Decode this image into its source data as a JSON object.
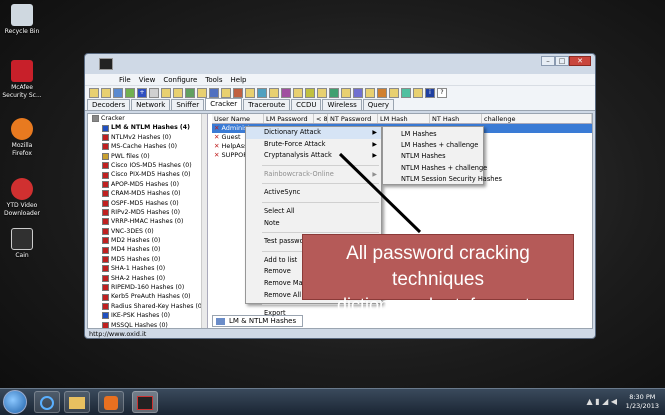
{
  "desktop": {
    "icons": [
      {
        "label": "Recycle Bin",
        "color": "#cfd8e0"
      },
      {
        "label": "McAfee Security Sc...",
        "color": "#c8202a"
      },
      {
        "label": "Mozilla Firefox",
        "color": "#e87a20"
      },
      {
        "label": "YTD Video Downloader",
        "color": "#d03030"
      },
      {
        "label": "Cain",
        "color": "#303030"
      }
    ]
  },
  "window": {
    "menu": [
      "File",
      "View",
      "Configure",
      "Tools",
      "Help"
    ],
    "tabs": [
      "Decoders",
      "Network",
      "Sniffer",
      "Cracker",
      "Traceroute",
      "CCDU",
      "Wireless",
      "Query"
    ],
    "active_tab": "Cracker",
    "tree": {
      "root": "Cracker",
      "items": [
        {
          "label": "LM & NTLM Hashes (4)",
          "bold": true
        },
        {
          "label": "NTLMv2 Hashes (0)"
        },
        {
          "label": "MS-Cache Hashes (0)"
        },
        {
          "label": "PWL files (0)"
        },
        {
          "label": "Cisco IOS-MD5 Hashes (0)"
        },
        {
          "label": "Cisco PIX-MD5 Hashes (0)"
        },
        {
          "label": "APOP-MD5 Hashes (0)"
        },
        {
          "label": "CRAM-MD5 Hashes (0)"
        },
        {
          "label": "OSPF-MD5 Hashes (0)"
        },
        {
          "label": "RIPv2-MD5 Hashes (0)"
        },
        {
          "label": "VRRP-HMAC Hashes (0)"
        },
        {
          "label": "VNC-3DES (0)"
        },
        {
          "label": "MD2 Hashes (0)"
        },
        {
          "label": "MD4 Hashes (0)"
        },
        {
          "label": "MD5 Hashes (0)"
        },
        {
          "label": "SHA-1 Hashes (0)"
        },
        {
          "label": "SHA-2 Hashes (0)"
        },
        {
          "label": "RIPEMD-160 Hashes (0)"
        },
        {
          "label": "Kerb5 PreAuth Hashes (0)"
        },
        {
          "label": "Radius Shared-Key Hashes (0)"
        },
        {
          "label": "IKE-PSK Hashes (0)"
        },
        {
          "label": "MSSQL Hashes (0)"
        }
      ]
    },
    "grid": {
      "columns": [
        "User Name",
        "LM Password",
        "< 8",
        "NT Password",
        "LM Hash",
        "NT Hash",
        "challenge"
      ],
      "rows": [
        "Administr",
        "Guest",
        "HelpAssis",
        "SUPPORT"
      ]
    },
    "bottom_tab": "LM & NTLM Hashes",
    "status": "http://www.oxid.it"
  },
  "context_menu": {
    "items": [
      {
        "label": "Dictionary Attack",
        "submenu": true,
        "highlight": true
      },
      {
        "label": "Brute-Force Attack",
        "submenu": true
      },
      {
        "label": "Cryptanalysis Attack",
        "submenu": true
      },
      {
        "sep": true
      },
      {
        "label": "Rainbowcrack-Online",
        "submenu": true,
        "disabled": true
      },
      {
        "sep": true
      },
      {
        "label": "ActiveSync"
      },
      {
        "sep": true
      },
      {
        "label": "Select All"
      },
      {
        "label": "Note"
      },
      {
        "sep": true
      },
      {
        "label": "Test password"
      },
      {
        "sep": true
      },
      {
        "label": "Add to list"
      },
      {
        "label": "Remove"
      },
      {
        "label": "Remove Machine Accounts"
      },
      {
        "label": "Remove All"
      },
      {
        "sep": true
      },
      {
        "label": "Export"
      }
    ]
  },
  "submenu": [
    "LM Hashes",
    "LM Hashes + challenge",
    "NTLM Hashes",
    "NTLM Hashes + challenge",
    "NTLM Session Security Hashes"
  ],
  "annotation": {
    "line1": "All password cracking techniques",
    "line2": "dictionary , bruteforce,etc"
  },
  "taskbar": {
    "time": "8:30 PM",
    "date": "1/23/2013"
  }
}
